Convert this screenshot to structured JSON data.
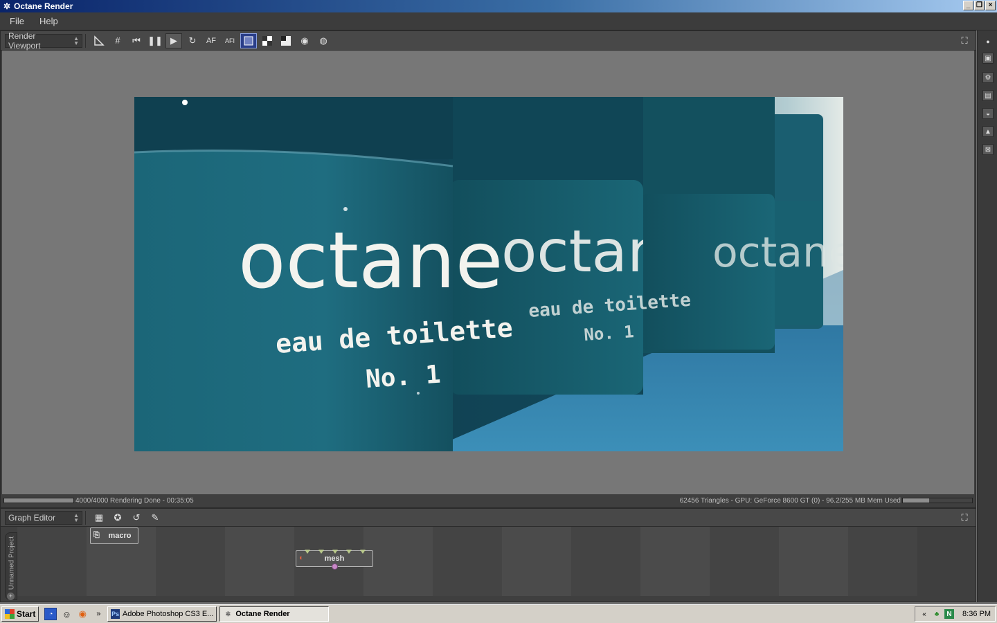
{
  "window": {
    "title": "Octane Render",
    "buttons": [
      "_",
      "❐",
      "×"
    ]
  },
  "menu": [
    "File",
    "Help"
  ],
  "viewport": {
    "dropdown_label": "Render Viewport",
    "toolbar_icons": [
      "ruler-icon",
      "grid-icon",
      "restart-icon",
      "pause-icon",
      "play-icon",
      "refresh-icon",
      "autofocus-icon",
      "autofocus-pick-icon",
      "display-mode-icon",
      "alpha-checker-icon",
      "tonemap-icon",
      "zoom-in-icon",
      "zoom-out-icon"
    ],
    "af_label": "AF",
    "afi_label": "AFI",
    "image_text": {
      "brand": "octane",
      "subtitle": "eau de toilette",
      "number": "No. 1"
    }
  },
  "status": {
    "progress_text": "4000/4000 Rendering Done - 00:35:05",
    "progress_fraction": 1.0,
    "info_text": "62456 Triangles - GPU: GeForce 8600 GT (0) - 96.2/255 MB Mem Used",
    "mem_fraction": 0.38
  },
  "graph_editor": {
    "dropdown_label": "Graph Editor",
    "project_tab": "Unnamed Project",
    "nodes": [
      {
        "label": "macro",
        "icon": "macro-icon"
      },
      {
        "label": "mesh",
        "icon": "mesh-icon"
      }
    ]
  },
  "taskbar": {
    "start_label": "Start",
    "tasks": [
      {
        "label": "Adobe Photoshop CS3 E...",
        "icon": "Ps"
      },
      {
        "label": "Octane Render",
        "icon": ""
      }
    ],
    "clock": "8:36 PM"
  }
}
